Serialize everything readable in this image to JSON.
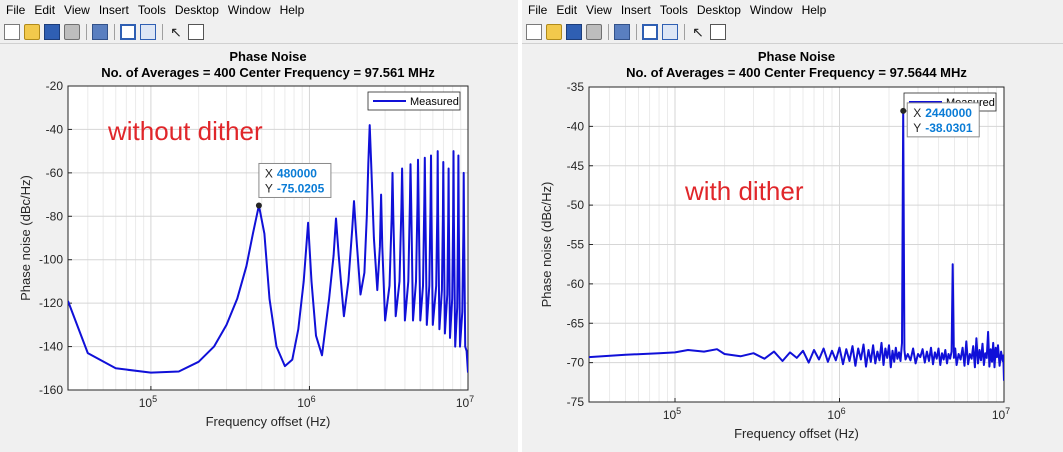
{
  "menu": [
    "File",
    "Edit",
    "View",
    "Insert",
    "Tools",
    "Desktop",
    "Window",
    "Help"
  ],
  "colors": {
    "series": "#1010d8",
    "annotation": "#e0262a",
    "datatip_value": "#0a7cd6"
  },
  "chart_data": [
    {
      "type": "line",
      "title": "Phase Noise",
      "subtitle": "No. of Averages = 400 Center Frequency = 97.561 MHz",
      "xlabel": "Frequency offset (Hz)",
      "ylabel": "Phase noise (dBc/Hz)",
      "xscale": "log",
      "xlim": [
        30000,
        10000000
      ],
      "ylim": [
        -160,
        -20
      ],
      "yticks": [
        -20,
        -40,
        -60,
        -80,
        -100,
        -120,
        -140,
        -160
      ],
      "xticks": [
        {
          "value": 100000,
          "base": "10",
          "exp": "5"
        },
        {
          "value": 1000000,
          "base": "10",
          "exp": "6"
        },
        {
          "value": 10000000,
          "base": "10",
          "exp": "7"
        }
      ],
      "grid": true,
      "legend": {
        "entries": [
          "Measured"
        ],
        "placement": "top-right"
      },
      "annotation_text": "without dither",
      "datatip": {
        "x": 480000,
        "y": -75.0205,
        "x_label": "X",
        "y_label": "Y",
        "x_text": "480000",
        "y_text": "-75.0205"
      },
      "series": [
        {
          "name": "Measured",
          "x": [
            30000,
            40000,
            60000,
            100000,
            150000,
            200000,
            250000,
            300000,
            350000,
            400000,
            440000,
            480000,
            520000,
            560000,
            620000,
            700000,
            780000,
            850000,
            920000,
            980000,
            1030000,
            1100000,
            1200000,
            1330000,
            1420000,
            1470000,
            1530000,
            1650000,
            1760000,
            1860000,
            1910000,
            1960000,
            2100000,
            2220000,
            2300000,
            2350000,
            2400000,
            2450000,
            2550000,
            2680000,
            2780000,
            2830000,
            2880000,
            3000000,
            3200000,
            3300000,
            3340000,
            3380000,
            3500000,
            3700000,
            3800000,
            3840000,
            3880000,
            4000000,
            4200000,
            4300000,
            4340000,
            4380000,
            4500000,
            4700000,
            4800000,
            4840000,
            4880000,
            5000000,
            5200000,
            5300000,
            5340000,
            5380000,
            5500000,
            5700000,
            5800000,
            5840000,
            5880000,
            6000000,
            6300000,
            6400000,
            6440000,
            6480000,
            6600000,
            6850000,
            6950000,
            6990000,
            7030000,
            7150000,
            7400000,
            7500000,
            7540000,
            7580000,
            7700000,
            7950000,
            8050000,
            8100000,
            8150000,
            8300000,
            8550000,
            8650000,
            8700000,
            8750000,
            8900000,
            9200000,
            9350000,
            9400000,
            9450000,
            9600000,
            9800000,
            10000000
          ],
          "y": [
            -119,
            -143,
            -150,
            -152,
            -151.5,
            -147,
            -140,
            -130,
            -118,
            -103,
            -88,
            -75,
            -88,
            -118,
            -140,
            -149,
            -146,
            -132,
            -110,
            -83,
            -110,
            -135,
            -144,
            -118,
            -98,
            -81,
            -98,
            -126,
            -110,
            -86,
            -73,
            -86,
            -116,
            -106,
            -80,
            -56,
            -38,
            -56,
            -90,
            -114,
            -94,
            -70,
            -94,
            -128,
            -112,
            -80,
            -60,
            -80,
            -126,
            -110,
            -76,
            -58,
            -76,
            -128,
            -110,
            -74,
            -56,
            -74,
            -128,
            -110,
            -74,
            -54,
            -74,
            -128,
            -112,
            -74,
            -53,
            -74,
            -130,
            -112,
            -76,
            -52,
            -76,
            -130,
            -112,
            -78,
            -50,
            -78,
            -132,
            -114,
            -80,
            -55,
            -80,
            -134,
            -116,
            -82,
            -58,
            -82,
            -136,
            -118,
            -82,
            -50,
            -82,
            -140,
            -122,
            -84,
            -52,
            -84,
            -140,
            -124,
            -86,
            -60,
            -86,
            -140,
            -142,
            -152
          ]
        }
      ]
    },
    {
      "type": "line",
      "title": "Phase Noise",
      "subtitle": "No. of Averages = 400 Center Frequency = 97.5644 MHz",
      "xlabel": "Frequency offset (Hz)",
      "ylabel": "Phase noise (dBc/Hz)",
      "xscale": "log",
      "xlim": [
        30000,
        10000000
      ],
      "ylim": [
        -75,
        -35
      ],
      "yticks": [
        -35,
        -40,
        -45,
        -50,
        -55,
        -60,
        -65,
        -70,
        -75
      ],
      "xticks": [
        {
          "value": 100000,
          "base": "10",
          "exp": "5"
        },
        {
          "value": 1000000,
          "base": "10",
          "exp": "6"
        },
        {
          "value": 10000000,
          "base": "10",
          "exp": "7"
        }
      ],
      "grid": true,
      "legend": {
        "entries": [
          "Measured"
        ],
        "placement": "top-right"
      },
      "annotation_text": "with dither",
      "datatip": {
        "x": 2440000,
        "y": -38.0301,
        "x_label": "X",
        "y_label": "Y",
        "x_text": "2440000",
        "y_text": "-38.0301"
      },
      "series": [
        {
          "name": "Measured",
          "x": [
            30000,
            50000,
            80000,
            100000,
            120000,
            150000,
            180000,
            200000,
            250000,
            300000,
            350000,
            400000,
            450000,
            500000,
            550000,
            600000,
            650000,
            700000,
            750000,
            800000,
            850000,
            900000,
            950000,
            1000000,
            1050000,
            1100000,
            1150000,
            1200000,
            1250000,
            1300000,
            1350000,
            1400000,
            1450000,
            1500000,
            1550000,
            1600000,
            1650000,
            1700000,
            1750000,
            1800000,
            1850000,
            1900000,
            1950000,
            2000000,
            2050000,
            2100000,
            2150000,
            2200000,
            2250000,
            2300000,
            2350000,
            2400000,
            2440000,
            2480000,
            2520000,
            2600000,
            2700000,
            2800000,
            2900000,
            3000000,
            3100000,
            3200000,
            3300000,
            3400000,
            3500000,
            3600000,
            3700000,
            3800000,
            3900000,
            4000000,
            4100000,
            4200000,
            4300000,
            4400000,
            4500000,
            4600000,
            4700000,
            4800000,
            4880000,
            4960000,
            5050000,
            5150000,
            5300000,
            5450000,
            5600000,
            5750000,
            5900000,
            6050000,
            6200000,
            6350000,
            6500000,
            6650000,
            6800000,
            6950000,
            7100000,
            7250000,
            7400000,
            7550000,
            7700000,
            7850000,
            8000000,
            8150000,
            8300000,
            8450000,
            8600000,
            8750000,
            8900000,
            9050000,
            9200000,
            9400000,
            9600000,
            9800000,
            9900000,
            10000000
          ],
          "y": [
            -69.3,
            -69,
            -68.8,
            -68.7,
            -68.4,
            -68.6,
            -68.3,
            -68.9,
            -69.2,
            -68.8,
            -69.5,
            -68.6,
            -69.8,
            -68.7,
            -69.4,
            -68.5,
            -70,
            -68.4,
            -69.6,
            -68.2,
            -69.9,
            -68.5,
            -69.7,
            -68.1,
            -70.2,
            -68.3,
            -69.8,
            -67.9,
            -70.4,
            -68.2,
            -69.6,
            -67.7,
            -70.5,
            -68.4,
            -69.9,
            -67.8,
            -70.1,
            -68.6,
            -69.7,
            -67.5,
            -70.3,
            -68.2,
            -69.4,
            -67.8,
            -70.6,
            -68.5,
            -69.9,
            -68.1,
            -69.5,
            -68.7,
            -69.8,
            -67.5,
            -38.03,
            -68.4,
            -69.6,
            -68.9,
            -69.7,
            -68.2,
            -70.1,
            -68.9,
            -69.3,
            -68.3,
            -70,
            -68.6,
            -69.8,
            -68.1,
            -70.2,
            -68.7,
            -69.5,
            -68.2,
            -70.3,
            -68.8,
            -69.6,
            -68.4,
            -70.1,
            -68.9,
            -69.5,
            -68.6,
            -57.5,
            -69.4,
            -68.2,
            -70.3,
            -68.9,
            -69.6,
            -68.1,
            -70.4,
            -67.3,
            -70.2,
            -68.9,
            -69.5,
            -67.9,
            -70.6,
            -66.9,
            -70.1,
            -68.4,
            -69.7,
            -67.6,
            -70.3,
            -68.8,
            -69.4,
            -66.1,
            -70.5,
            -68.3,
            -69.9,
            -67.5,
            -70.6,
            -68.1,
            -69.3,
            -67.8,
            -70.4,
            -68.6,
            -69.8,
            -69.1,
            -72.3
          ]
        }
      ]
    }
  ]
}
